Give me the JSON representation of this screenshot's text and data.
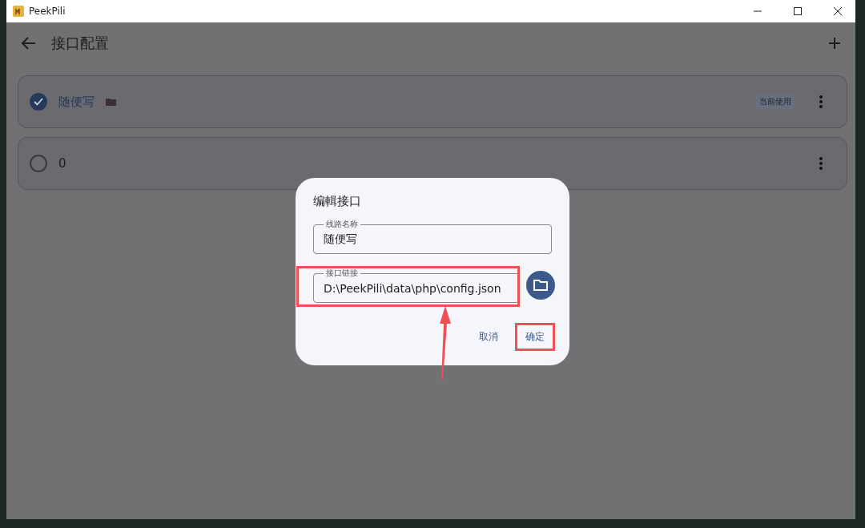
{
  "window": {
    "title": "PeekPili"
  },
  "header": {
    "title": "接口配置"
  },
  "items": [
    {
      "name": "随便写",
      "selected": true,
      "local": true,
      "badge": "当前使用"
    },
    {
      "name": "0",
      "selected": false,
      "local": false
    }
  ],
  "dialog": {
    "title": "编輯接口",
    "fields": [
      {
        "label": "线路名称",
        "value": "随便写",
        "highlighted": false,
        "picker": false
      },
      {
        "label": "接口链接",
        "value": "D:\\PeekPili\\data\\php\\config.json",
        "highlighted": true,
        "picker": true
      }
    ],
    "buttons": [
      {
        "label": "取消",
        "highlighted": false
      },
      {
        "label": "确定",
        "highlighted": true
      }
    ]
  }
}
